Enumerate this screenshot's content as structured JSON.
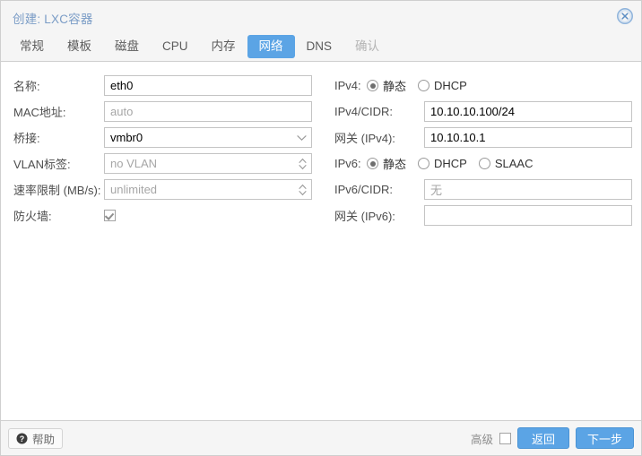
{
  "window": {
    "title": "创建: LXC容器",
    "close_icon": "close-circle-icon"
  },
  "tabs": [
    {
      "label": "常规",
      "state": "normal"
    },
    {
      "label": "模板",
      "state": "normal"
    },
    {
      "label": "磁盘",
      "state": "normal"
    },
    {
      "label": "CPU",
      "state": "normal"
    },
    {
      "label": "内存",
      "state": "normal"
    },
    {
      "label": "网络",
      "state": "active"
    },
    {
      "label": "DNS",
      "state": "normal"
    },
    {
      "label": "确认",
      "state": "disabled"
    }
  ],
  "form": {
    "left": {
      "name": {
        "label": "名称:",
        "value": "eth0"
      },
      "mac": {
        "label": "MAC地址:",
        "value": "auto",
        "is_placeholder": true
      },
      "bridge": {
        "label": "桥接:",
        "value": "vmbr0"
      },
      "vlan": {
        "label": "VLAN标签:",
        "value": "no VLAN",
        "is_placeholder": true
      },
      "rate": {
        "label": "速率限制 (MB/s):",
        "value": "unlimited",
        "is_placeholder": true
      },
      "firewall": {
        "label": "防火墙:",
        "checked": true
      }
    },
    "right": {
      "ipv4": {
        "label": "IPv4:",
        "options": [
          {
            "label": "静态",
            "selected": true
          },
          {
            "label": "DHCP",
            "selected": false
          }
        ]
      },
      "ipv4_cidr": {
        "label": "IPv4/CIDR:",
        "value": "10.10.10.100/24"
      },
      "ipv4_gw": {
        "label": "网关 (IPv4):",
        "value": "10.10.10.1"
      },
      "ipv6": {
        "label": "IPv6:",
        "options": [
          {
            "label": "静态",
            "selected": true
          },
          {
            "label": "DHCP",
            "selected": false
          },
          {
            "label": "SLAAC",
            "selected": false
          }
        ]
      },
      "ipv6_cidr": {
        "label": "IPv6/CIDR:",
        "value": "无",
        "is_placeholder": true
      },
      "ipv6_gw": {
        "label": "网关 (IPv6):",
        "value": ""
      }
    }
  },
  "footer": {
    "help_label": "帮助",
    "help_icon": "question-circle-icon",
    "advanced_label": "高级",
    "advanced_checked": false,
    "back_label": "返回",
    "next_label": "下一步"
  },
  "colors": {
    "accent": "#5ba4e5",
    "title": "#7a9cc6",
    "chrome": "#f5f5f5",
    "border": "#cfcfcf"
  }
}
